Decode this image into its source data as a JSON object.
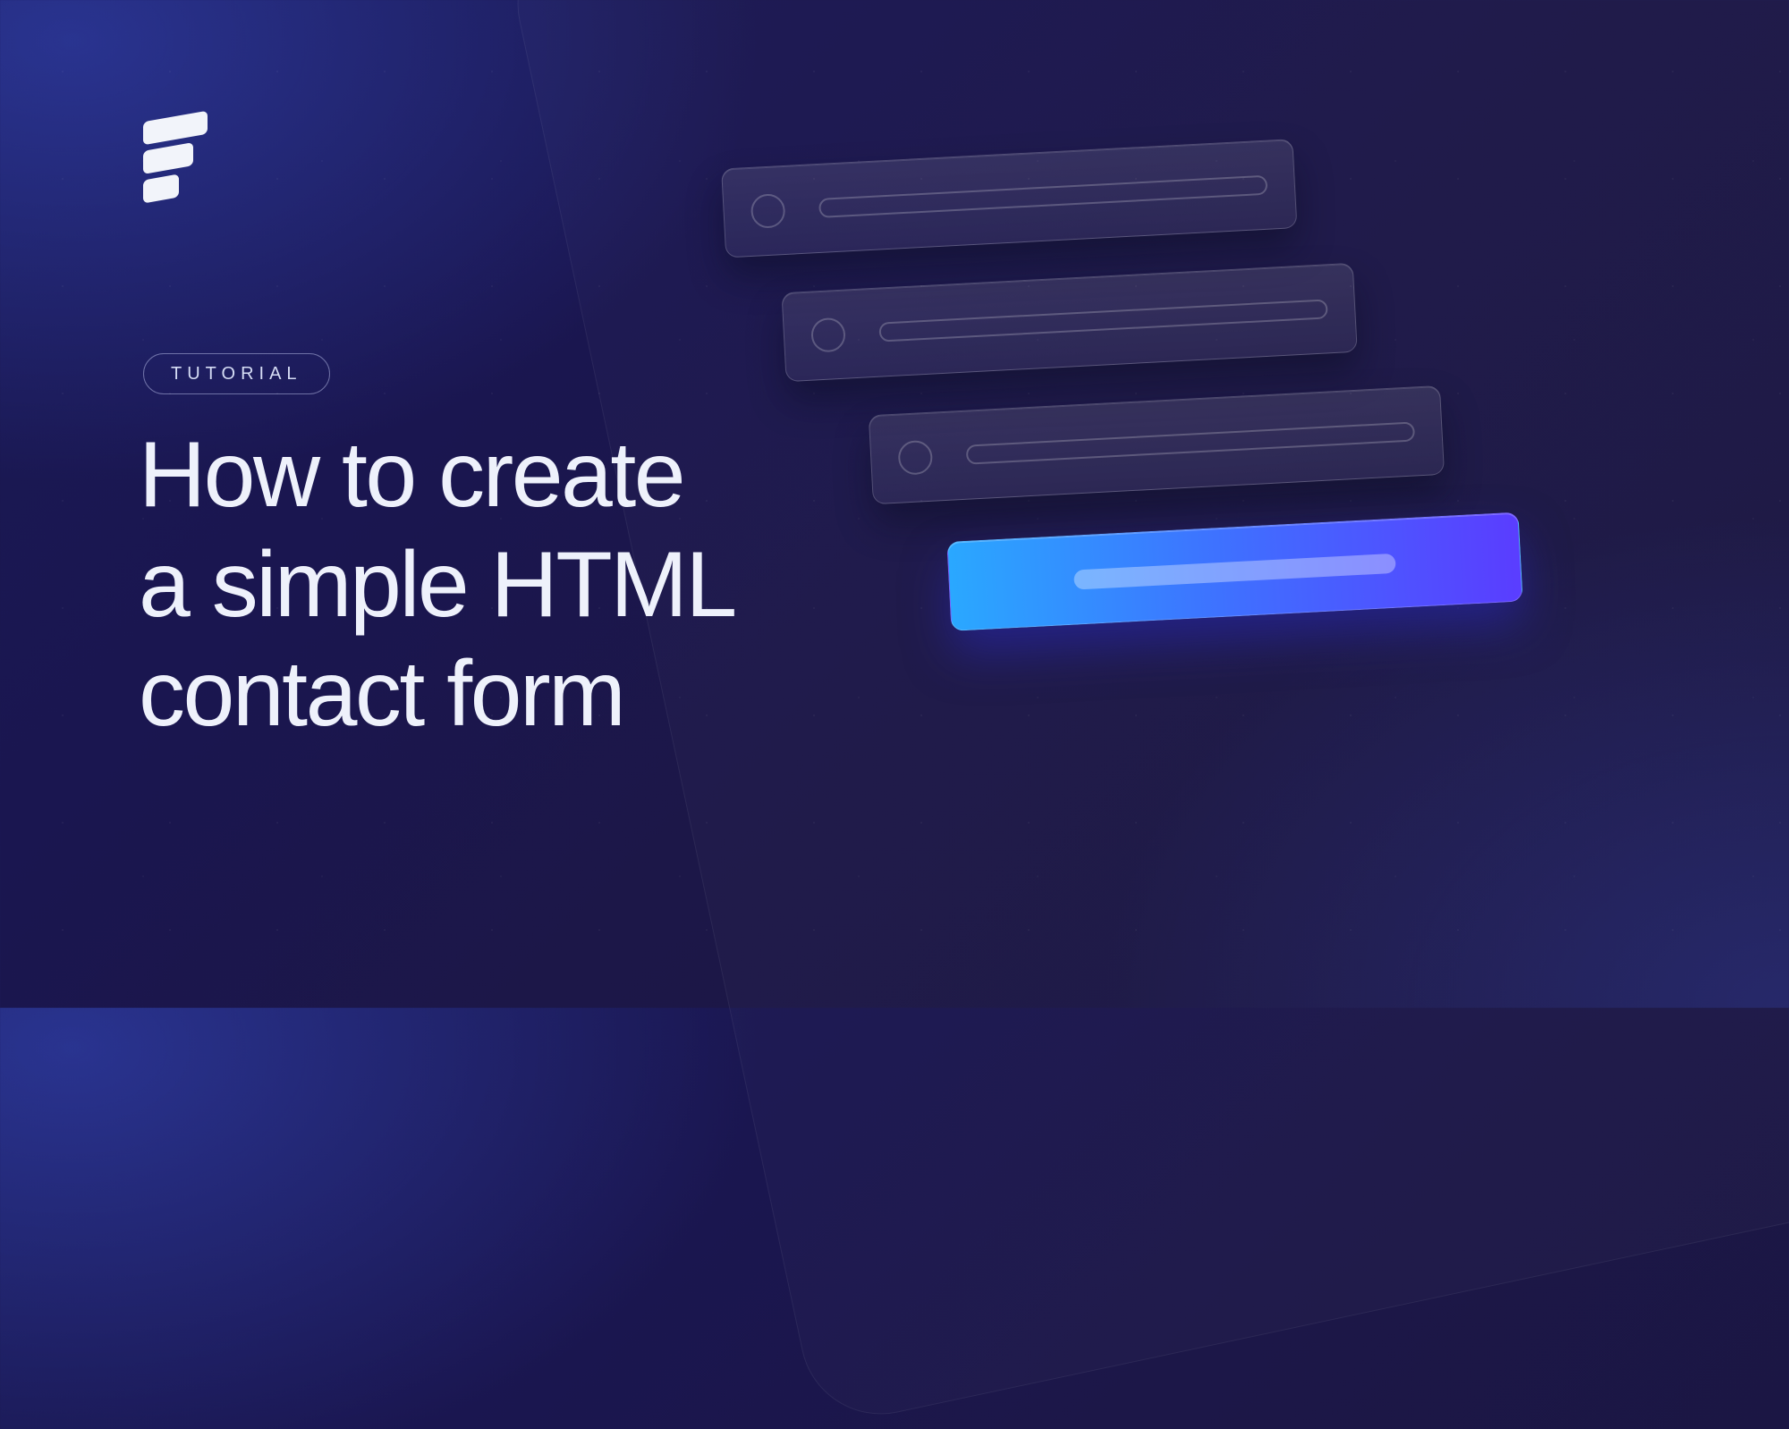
{
  "badge": {
    "label": "TUTORIAL"
  },
  "headline": {
    "line1": "How to create",
    "line2": "a simple HTML",
    "line3": "contact form"
  },
  "logo_name": "formspree-logo",
  "colors": {
    "accent_start": "#2aa8ff",
    "accent_end": "#5a3dff",
    "text": "#eef1fb",
    "background_deep": "#1a1650"
  }
}
